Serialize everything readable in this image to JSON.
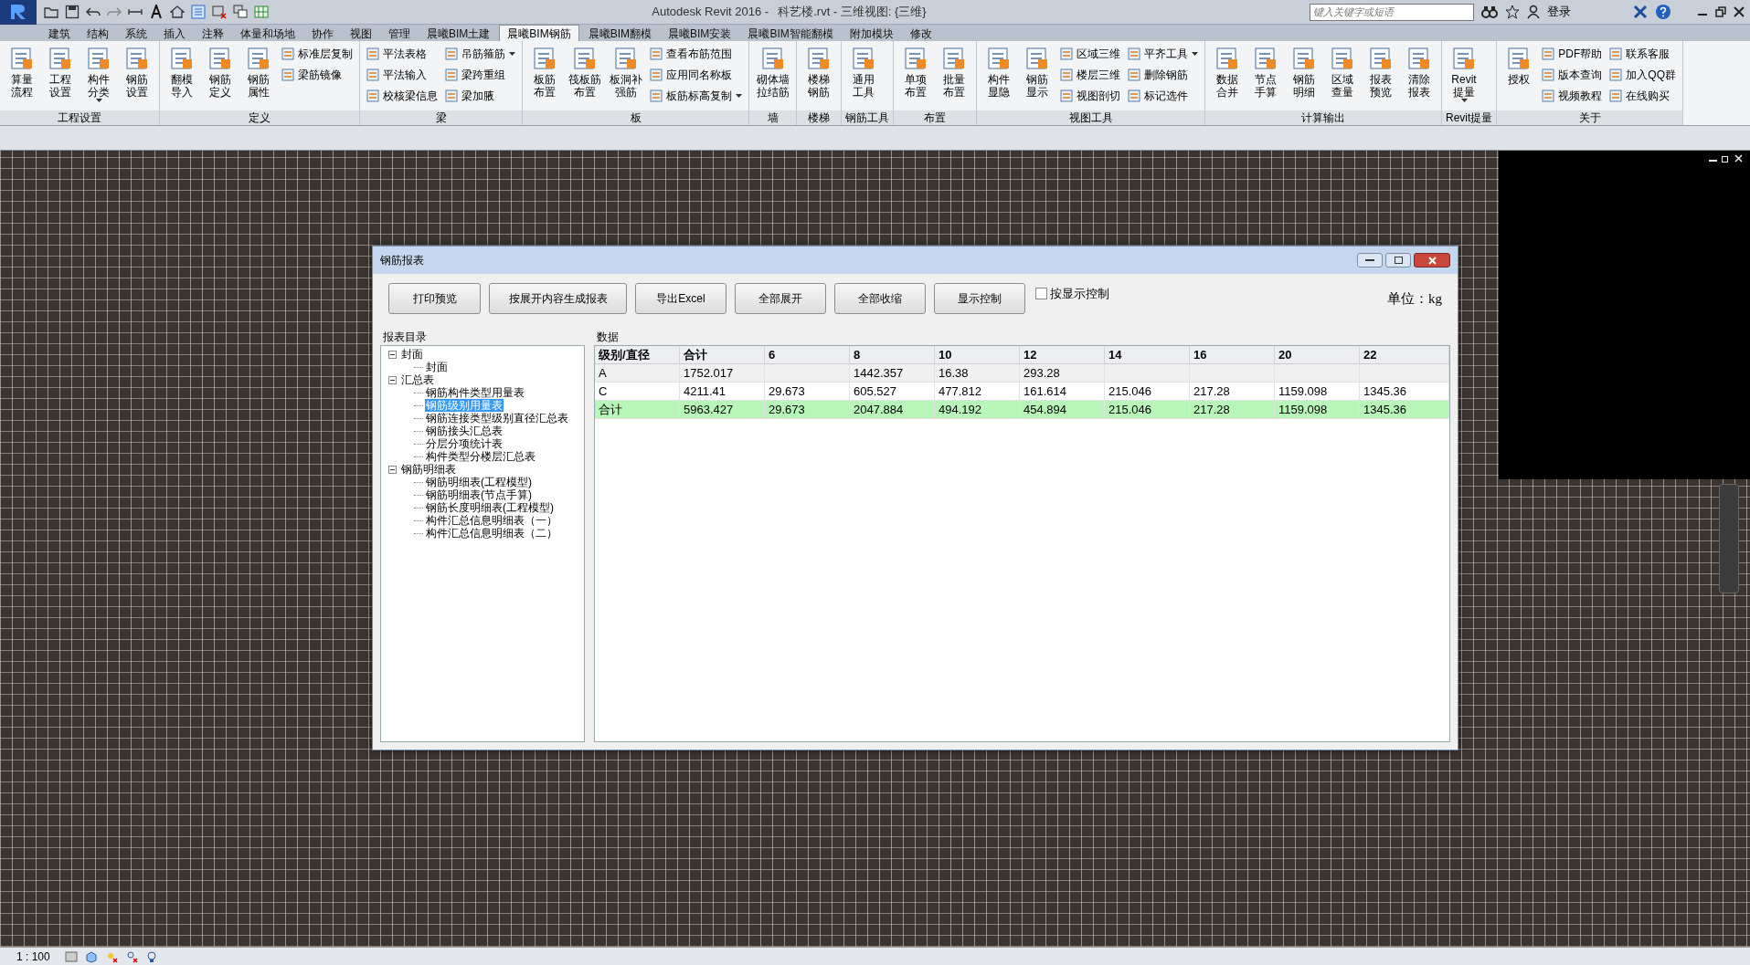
{
  "window": {
    "app_title": "Autodesk Revit 2016 -",
    "document_title": "科艺楼.rvt - 三维视图: {三维}",
    "search": {
      "placeholder": "键入关键字或短语"
    },
    "sign_in": "登录"
  },
  "tabs": [
    {
      "label": "建筑",
      "selected": false
    },
    {
      "label": "结构",
      "selected": false
    },
    {
      "label": "系统",
      "selected": false
    },
    {
      "label": "插入",
      "selected": false
    },
    {
      "label": "注释",
      "selected": false
    },
    {
      "label": "体量和场地",
      "selected": false
    },
    {
      "label": "协作",
      "selected": false
    },
    {
      "label": "视图",
      "selected": false
    },
    {
      "label": "管理",
      "selected": false
    },
    {
      "label": "晨曦BIM土建",
      "selected": false
    },
    {
      "label": "晨曦BIM钢筋",
      "selected": true
    },
    {
      "label": "晨曦BIM翻模",
      "selected": false
    },
    {
      "label": "晨曦BIM安装",
      "selected": false
    },
    {
      "label": "晨曦BIM智能翻模",
      "selected": false
    },
    {
      "label": "附加模块",
      "selected": false
    },
    {
      "label": "修改",
      "selected": false
    }
  ],
  "ribbon_panels": [
    {
      "title": "工程设置",
      "tools": [
        {
          "kind": "large",
          "label": "算量流程"
        },
        {
          "kind": "large",
          "label": "工程设置"
        },
        {
          "kind": "large",
          "label": "构件分类",
          "dropdown": true
        },
        {
          "kind": "large",
          "label": "钢筋设置"
        }
      ]
    },
    {
      "title": "定义",
      "tools": [
        {
          "kind": "large",
          "label": "翻模导入"
        },
        {
          "kind": "large",
          "label": "钢筋定义"
        },
        {
          "kind": "large",
          "label": "钢筋属性"
        },
        {
          "kind": "small",
          "label": "标准层复制"
        },
        {
          "kind": "small",
          "label": "梁筋镜像"
        }
      ]
    },
    {
      "title": "梁",
      "tools": [
        {
          "kind": "small",
          "label": "平法表格"
        },
        {
          "kind": "small",
          "label": "平法输入"
        },
        {
          "kind": "small",
          "label": "校核梁信息"
        },
        {
          "kind": "small",
          "label": "吊筋箍筋",
          "dropdown": true
        },
        {
          "kind": "small",
          "label": "梁跨重组"
        },
        {
          "kind": "small",
          "label": "梁加腋"
        }
      ]
    },
    {
      "title": "板",
      "tools": [
        {
          "kind": "large",
          "label": "板筋布置"
        },
        {
          "kind": "large",
          "label": "筏板筋布置"
        },
        {
          "kind": "large",
          "label": "板洞补强筋"
        },
        {
          "kind": "small",
          "label": "查看布筋范围"
        },
        {
          "kind": "small",
          "label": "应用同名称板"
        },
        {
          "kind": "small",
          "label": "板筋标高复制",
          "dropdown": true
        }
      ]
    },
    {
      "title": "墙",
      "tools": [
        {
          "kind": "large",
          "label": "砌体墙拉结筋"
        }
      ]
    },
    {
      "title": "楼梯",
      "tools": [
        {
          "kind": "large",
          "label": "楼梯钢筋"
        }
      ]
    },
    {
      "title": "钢筋工具",
      "tools": [
        {
          "kind": "large",
          "label": "通用工具"
        }
      ]
    },
    {
      "title": "布置",
      "tools": [
        {
          "kind": "large",
          "label": "单项布置"
        },
        {
          "kind": "large",
          "label": "批量布置"
        }
      ]
    },
    {
      "title": "视图工具",
      "tools": [
        {
          "kind": "large",
          "label": "构件显隐"
        },
        {
          "kind": "large",
          "label": "钢筋显示"
        },
        {
          "kind": "small",
          "label": "区域三维"
        },
        {
          "kind": "small",
          "label": "楼层三维"
        },
        {
          "kind": "small",
          "label": "视图剖切"
        },
        {
          "kind": "small",
          "label": "平齐工具",
          "dropdown": true
        },
        {
          "kind": "small",
          "label": "删除钢筋"
        },
        {
          "kind": "small",
          "label": "标记选件"
        }
      ]
    },
    {
      "title": "计算输出",
      "tools": [
        {
          "kind": "large",
          "label": "数据合并"
        },
        {
          "kind": "large",
          "label": "节点手算"
        },
        {
          "kind": "large",
          "label": "钢筋明细"
        },
        {
          "kind": "large",
          "label": "区域查量"
        },
        {
          "kind": "large",
          "label": "报表预览"
        },
        {
          "kind": "large",
          "label": "清除报表"
        }
      ]
    },
    {
      "title": "Revit提量",
      "tools": [
        {
          "kind": "large",
          "label": "Revit提量",
          "dropdown": true
        }
      ]
    },
    {
      "title": "关于",
      "tools": [
        {
          "kind": "large",
          "label": "授权"
        },
        {
          "kind": "small",
          "label": "PDF帮助"
        },
        {
          "kind": "small",
          "label": "版本查询"
        },
        {
          "kind": "small",
          "label": "视频教程"
        },
        {
          "kind": "small",
          "label": "联系客服"
        },
        {
          "kind": "small",
          "label": "加入QQ群"
        },
        {
          "kind": "small",
          "label": "在线购买"
        }
      ]
    }
  ],
  "dialog": {
    "title": "钢筋报表",
    "buttons": [
      "打印预览",
      "按展开内容生成报表",
      "导出Excel",
      "全部展开",
      "全部收缩",
      "显示控制"
    ],
    "checkbox": {
      "label": "按显示控制",
      "checked": false
    },
    "unit": "单位：kg",
    "tree_heading": "报表目录",
    "data_heading": "数据",
    "tree": [
      {
        "label": "封面",
        "expanded": true,
        "selected": false,
        "children": [
          {
            "label": "封面",
            "selected": false
          }
        ]
      },
      {
        "label": "汇总表",
        "expanded": true,
        "selected": false,
        "children": [
          {
            "label": "钢筋构件类型用量表",
            "selected": false
          },
          {
            "label": "钢筋级别用量表",
            "selected": true
          },
          {
            "label": "钢筋连接类型级别直径汇总表",
            "selected": false
          },
          {
            "label": "钢筋接头汇总表",
            "selected": false
          },
          {
            "label": "分层分项统计表",
            "selected": false
          },
          {
            "label": "构件类型分楼层汇总表",
            "selected": false
          }
        ]
      },
      {
        "label": "钢筋明细表",
        "expanded": true,
        "selected": false,
        "children": [
          {
            "label": "钢筋明细表(工程模型)",
            "selected": false
          },
          {
            "label": "钢筋明细表(节点手算)",
            "selected": false
          },
          {
            "label": "钢筋长度明细表(工程模型)",
            "selected": false
          },
          {
            "label": "构件汇总信息明细表（一）",
            "selected": false
          },
          {
            "label": "构件汇总信息明细表（二）",
            "selected": false
          }
        ]
      }
    ],
    "table": {
      "columns": [
        "级别/直径",
        "合计",
        "6",
        "8",
        "10",
        "12",
        "14",
        "16",
        "20",
        "22"
      ],
      "rows": [
        {
          "selected": false,
          "cells": [
            "A",
            "1752.017",
            "",
            "1442.357",
            "16.38",
            "293.28",
            "",
            "",
            "",
            ""
          ]
        },
        {
          "selected": false,
          "cells": [
            "C",
            "4211.41",
            "29.673",
            "605.527",
            "477.812",
            "161.614",
            "215.046",
            "217.28",
            "1159.098",
            "1345.36"
          ]
        },
        {
          "selected": true,
          "cells": [
            "合计",
            "5963.427",
            "29.673",
            "2047.884",
            "494.192",
            "454.894",
            "215.046",
            "217.28",
            "1159.098",
            "1345.36"
          ]
        }
      ]
    }
  },
  "status_bar": {
    "scale": "1 : 100"
  }
}
